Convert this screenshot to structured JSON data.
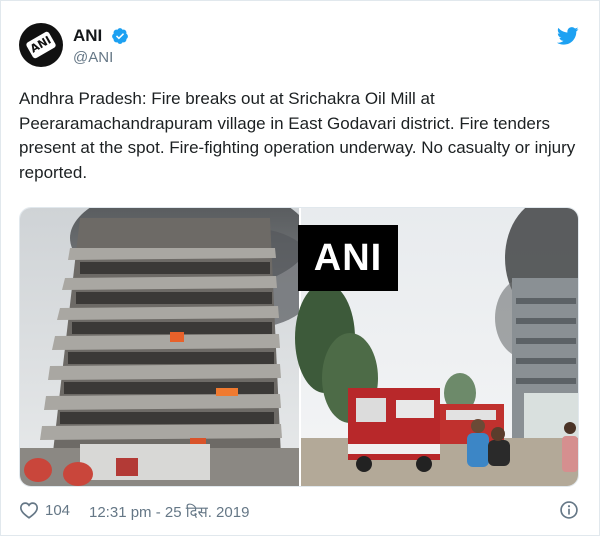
{
  "account": {
    "name": "ANI",
    "handle": "@ANI",
    "avatar_text": "ANI",
    "verified": true
  },
  "tweet": {
    "text": "Andhra Pradesh: Fire breaks out at Srichakra Oil Mill at Peeraramachandrapuram village in East Godavari district. Fire tenders present at the spot. Fire-fighting operation underway. No casualty or injury reported."
  },
  "media": {
    "watermark": "ANI",
    "images": [
      "burning-building-photo",
      "fire-tenders-photo"
    ]
  },
  "footer": {
    "likes": "104",
    "timestamp": "12:31 pm - 25 दिस. 2019"
  },
  "icons": {
    "verified": "verified-badge-icon",
    "brand": "twitter-bird-icon",
    "like": "heart-icon",
    "info": "info-icon"
  },
  "colors": {
    "accent": "#1da1f2",
    "muted": "#657786",
    "text": "#1c2022"
  }
}
